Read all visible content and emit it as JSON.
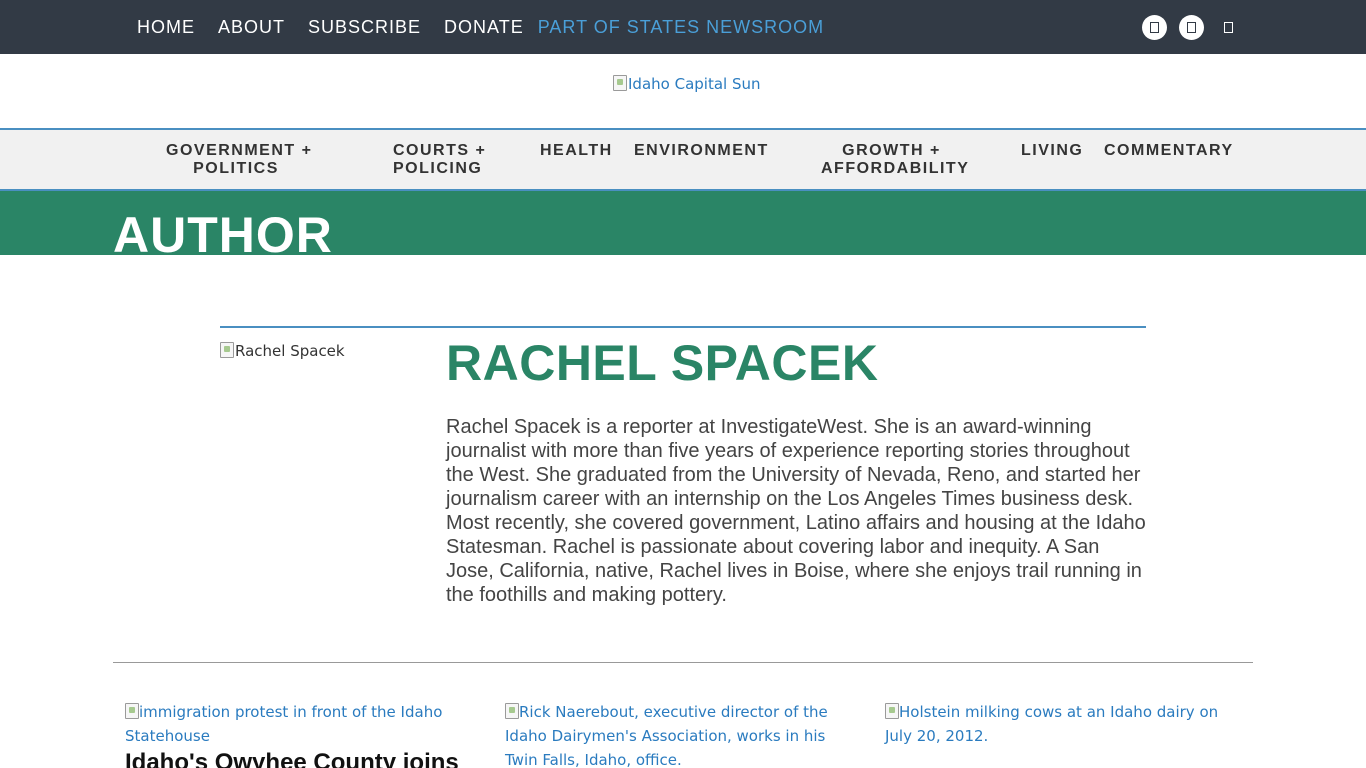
{
  "topbar": {
    "nav": [
      "HOME",
      "ABOUT",
      "SUBSCRIBE",
      "DONATE"
    ],
    "states_newsroom": "PART OF STATES NEWSROOM",
    "social_icons": [
      "facebook-icon",
      "twitter-icon",
      "instagram-icon"
    ]
  },
  "logo": {
    "alt": "Idaho Capital Sun"
  },
  "mainnav": {
    "items": [
      {
        "line1": "GOVERNMENT +",
        "line2": "POLITICS"
      },
      {
        "line1": "COURTS +",
        "line2": "POLICING"
      },
      {
        "line1": "HEALTH",
        "line2": ""
      },
      {
        "line1": "ENVIRONMENT",
        "line2": ""
      },
      {
        "line1": "GROWTH +",
        "line2": "AFFORDABILITY"
      },
      {
        "line1": "LIVING",
        "line2": ""
      },
      {
        "line1": "COMMENTARY",
        "line2": ""
      }
    ]
  },
  "page": {
    "heading": "AUTHOR"
  },
  "author": {
    "photo_alt": "Rachel Spacek",
    "name": "RACHEL SPACEK",
    "bio": "Rachel Spacek is a reporter at InvestigateWest. She is an award-winning journalist with more than five years of experience reporting stories throughout the West. She graduated from the University of Nevada, Reno, and started her journalism career with an internship on the Los Angeles Times business desk. Most recently, she covered government, Latino affairs and housing at the Idaho Statesman. Rachel is passionate about covering labor and inequity. A San Jose, California, native, Rachel lives in Boise, where she enjoys trail running in the foothills and making pottery."
  },
  "stories": [
    {
      "image_alt": "immigration protest in front of the Idaho Statehouse",
      "headline": "Idaho's Owyhee County joins"
    },
    {
      "image_alt": "Rick Naerebout, executive director of the Idaho Dairymen's Association, works in his Twin Falls, Idaho, office.",
      "headline": ""
    },
    {
      "image_alt": "Holstein milking cows at an Idaho dairy on July 20, 2012.",
      "headline": ""
    }
  ],
  "colors": {
    "topbar": "#323a45",
    "states_link": "#4a9fd8",
    "brand_green": "#2a8566",
    "link_blue": "#2a7bbf",
    "nav_border": "#4a8fc1"
  }
}
